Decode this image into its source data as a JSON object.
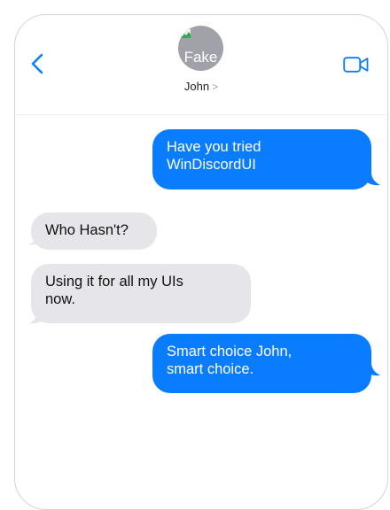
{
  "header": {
    "contact_name": "John",
    "contact_chevron": ">",
    "avatar_alt_text": "Fake"
  },
  "messages": [
    {
      "direction": "sent",
      "text": "Have you tried\nWinDiscordUI"
    },
    {
      "direction": "received",
      "text": "Who Hasn't?"
    },
    {
      "direction": "received",
      "text": "Using it for all my UIs\nnow."
    },
    {
      "direction": "sent",
      "text": "Smart choice John,\nsmart choice."
    }
  ],
  "colors": {
    "accent": "#0a7cff",
    "sent_bubble": "#0a7cff",
    "received_bubble": "#e5e5ea",
    "avatar_bg": "#a1a1aa"
  },
  "icons": {
    "back": "chevron-left-icon",
    "video": "video-camera-icon",
    "avatar_broken": "broken-image-icon"
  }
}
